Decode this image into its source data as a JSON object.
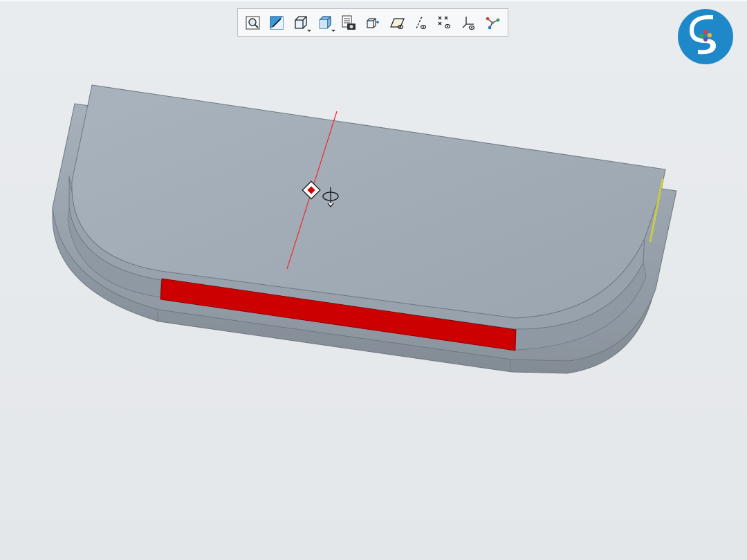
{
  "toolbar": {
    "buttons": [
      {
        "name": "zoom-fit-button",
        "icon": "magnifier-box-icon"
      },
      {
        "name": "zoom-window-button",
        "icon": "zoom-window-icon"
      },
      {
        "name": "view-orientation-button",
        "icon": "cube-orientation-icon"
      },
      {
        "name": "display-style-button",
        "icon": "shaded-cube-icon"
      },
      {
        "name": "view-manager-button",
        "icon": "view-manager-camera-icon"
      },
      {
        "name": "spin-center-button",
        "icon": "spin-center-icon"
      },
      {
        "name": "plane-display-button",
        "icon": "plane-display-icon"
      },
      {
        "name": "axis-display-button",
        "icon": "axis-display-icon"
      },
      {
        "name": "point-display-button",
        "icon": "point-display-icon"
      },
      {
        "name": "csys-display-button",
        "icon": "csys-display-icon"
      },
      {
        "name": "annotation-display-button",
        "icon": "annotation-node-icon"
      }
    ]
  },
  "colors": {
    "background": "#e6e9ec",
    "model_top": "#a3adb7",
    "model_side": "#8d969f",
    "highlight_face": "#cc0000",
    "axis_line": "#e8323a",
    "logo_blue": "#1f88c9"
  }
}
